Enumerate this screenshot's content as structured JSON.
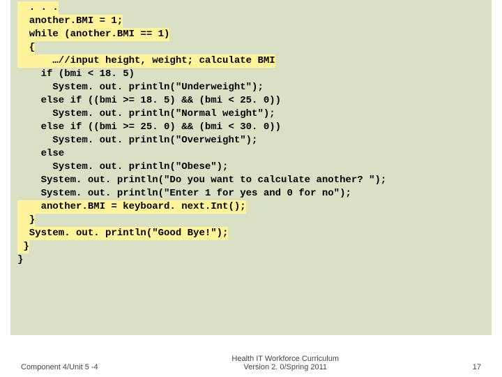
{
  "code": {
    "l1": "  . . .",
    "l2": "  another.BMI = 1;",
    "l3": "  while (another.BMI == 1)",
    "l4": "  {",
    "l5": "      …//input height, weight; calculate BMI",
    "l6": "    if (bmi < 18. 5)",
    "l7": "      System. out. println(\"Underweight\");",
    "l8": "    else if ((bmi >= 18. 5) && (bmi < 25. 0))",
    "l9": "      System. out. println(\"Normal weight\");",
    "l10": "    else if ((bmi >= 25. 0) && (bmi < 30. 0))",
    "l11": "      System. out. println(\"Overweight\");",
    "l12": "    else",
    "l13": "      System. out. println(\"Obese\");",
    "l14": "    System. out. println(\"Do you want to calculate another? \");",
    "l15": "    System. out. println(\"Enter 1 for yes and 0 for no\");",
    "l16": "    another.BMI = keyboard. next.Int();",
    "l17": "  }",
    "l18": "  System. out. println(\"Good Bye!\");",
    "l19": " }",
    "l20": "}"
  },
  "footer": {
    "left": "Component 4/Unit 5 -4",
    "center_l1": "Health IT Workforce Curriculum",
    "center_l2": "Version 2. 0/Spring 2011",
    "right": "17"
  }
}
